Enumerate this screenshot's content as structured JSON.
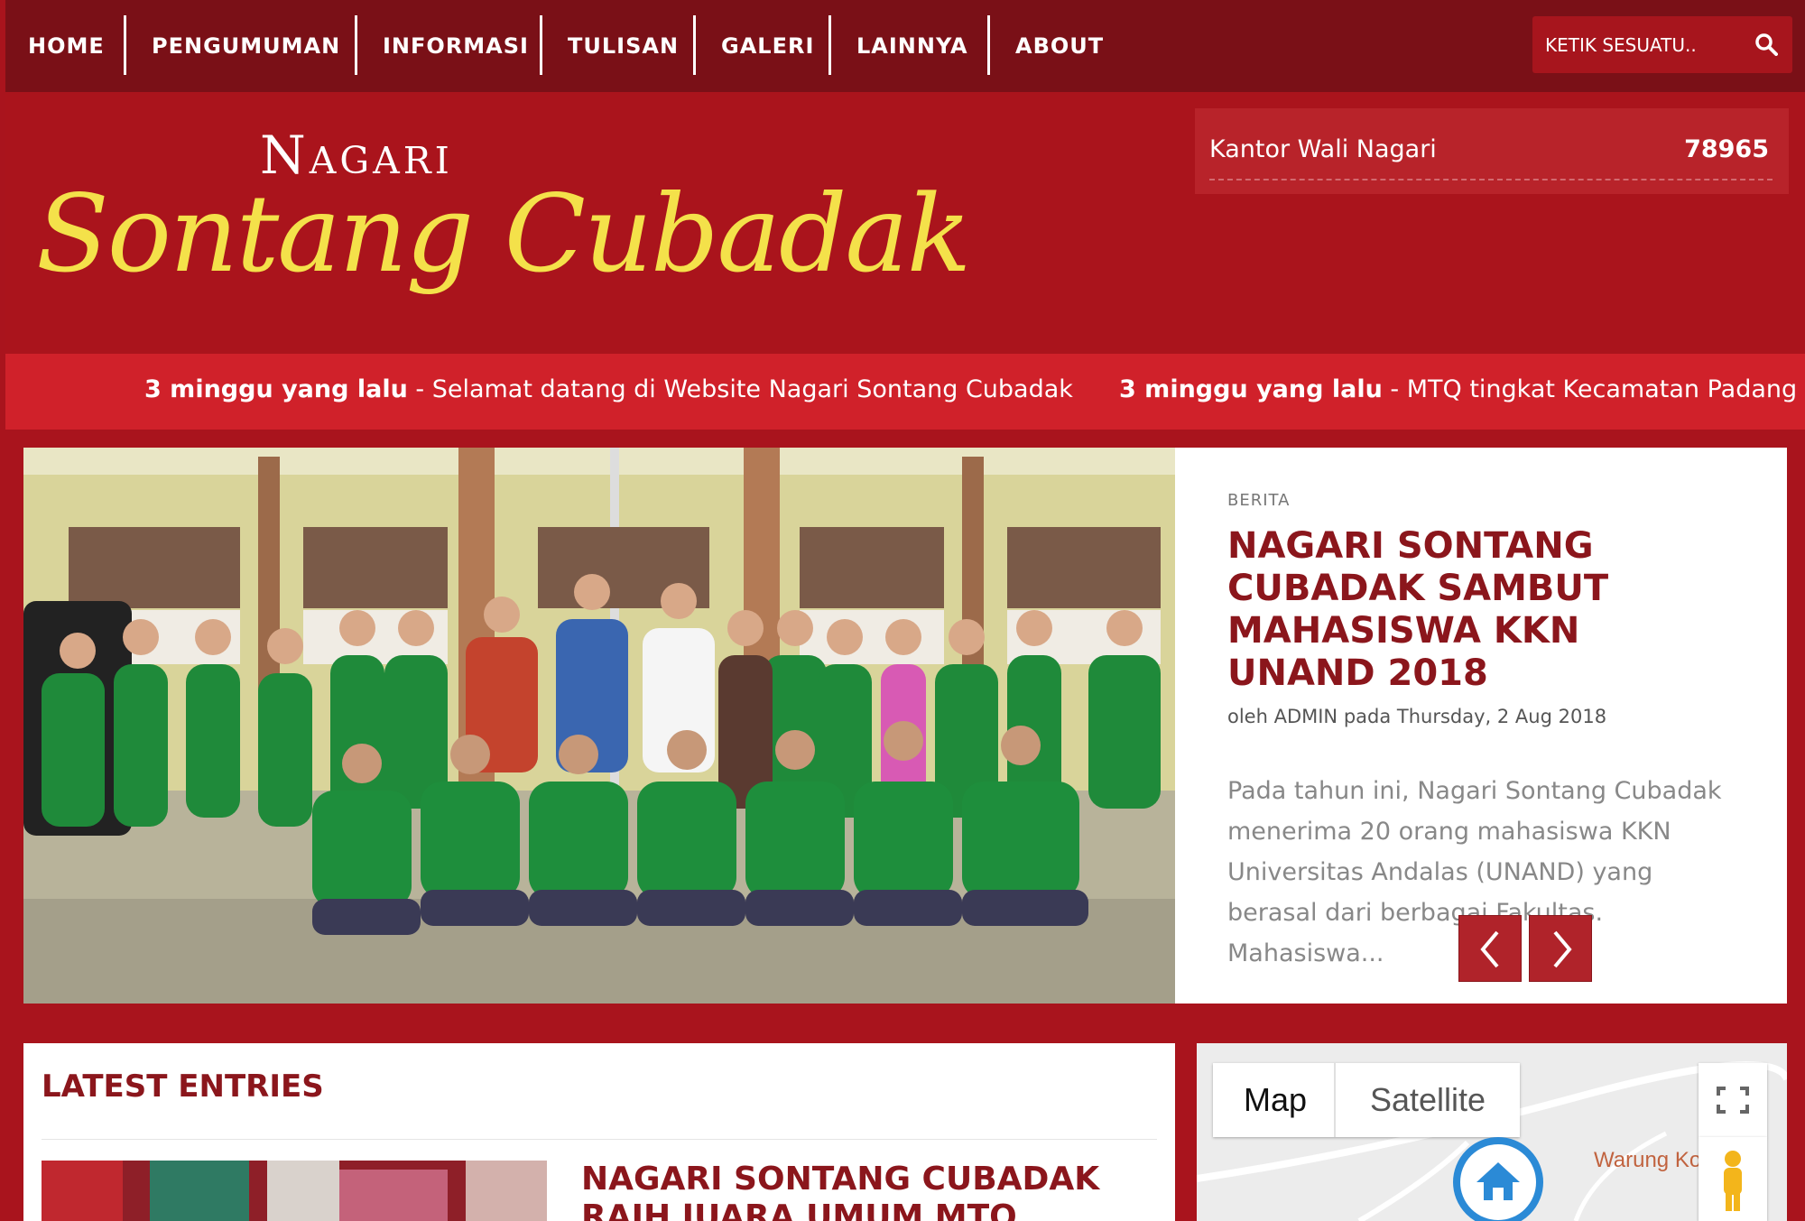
{
  "nav": {
    "items": [
      "HOME",
      "PENGUMUMAN",
      "INFORMASI",
      "TULISAN",
      "GALERI",
      "LAINNYA",
      "ABOUT"
    ],
    "search_placeholder": "KETIK SESUATU.."
  },
  "header": {
    "logo_top": "Nagari",
    "logo_script": "Sontang Cubadak",
    "counter_label": "Kantor Wali Nagari",
    "counter_value": "78965"
  },
  "ticker": {
    "items": [
      {
        "time": "3 minggu yang lalu",
        "text": " - Selamat datang di Website Nagari Sontang Cubadak"
      },
      {
        "time": "3 minggu yang lalu",
        "text": " - MTQ tingkat Kecamatan Padang Ge"
      }
    ]
  },
  "slider": {
    "category": "BERITA",
    "title": "Nagari Sontang Cubadak Sambut Mahasiswa KKN UNAND 2018",
    "byline": "oleh ADMIN pada Thursday, 2 Aug 2018",
    "excerpt": "Pada tahun ini,  Nagari Sontang Cubadak menerima 20 orang mahasiswa KKN Universitas Andalas (UNAND) yang berasal dari berbagai Fakultas. Mahasiswa..."
  },
  "latest": {
    "title": "LATEST ENTRIES",
    "entry_title": "Nagari Sontang Cubadak Raih Juara Umum MTQ"
  },
  "map": {
    "map_label": "Map",
    "satellite_label": "Satellite",
    "place_label": "Warung Ko"
  },
  "colors": {
    "nav_bg": "#7a1017",
    "header_bg": "#aa141c",
    "ticker_bg": "#d0212a",
    "headline": "#8b161c",
    "logo_script": "#f4e14a"
  }
}
